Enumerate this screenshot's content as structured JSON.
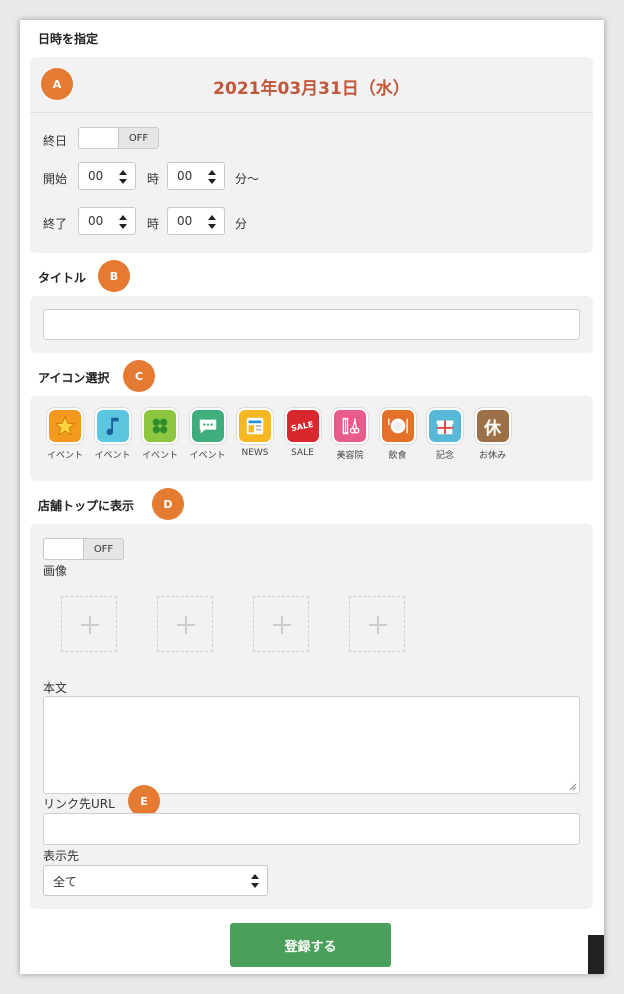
{
  "datetime": {
    "section_title": "日時を指定",
    "badge": "A",
    "date": "2021年03月31日（水）",
    "allday_label": "終日",
    "allday_toggle": "OFF",
    "start_label": "開始",
    "start_hour": "00",
    "start_minute": "00",
    "end_label": "終了",
    "end_hour": "00",
    "end_minute": "00",
    "hour_unit": "時",
    "minute_unit_start": "分～",
    "minute_unit_end": "分"
  },
  "title_section": {
    "label": "タイトル",
    "badge": "B",
    "value": ""
  },
  "icon_section": {
    "label": "アイコン選択",
    "badge": "C",
    "icons": [
      {
        "caption": "イベント",
        "name": "star-icon",
        "color": "#f39a1e"
      },
      {
        "caption": "イベント",
        "name": "music-note-icon",
        "color": "#5cc6e0"
      },
      {
        "caption": "イベント",
        "name": "clover-icon",
        "color": "#8cc63f"
      },
      {
        "caption": "イベント",
        "name": "chat-bubble-icon",
        "color": "#3fae7e"
      },
      {
        "caption": "NEWS",
        "name": "news-icon",
        "color": "#f5b823"
      },
      {
        "caption": "SALE",
        "name": "sale-icon",
        "color": "#d8272d",
        "text": "SALE"
      },
      {
        "caption": "美容院",
        "name": "comb-scissors-icon",
        "color": "#e85c8a"
      },
      {
        "caption": "飲食",
        "name": "plate-icon",
        "color": "#e5702a"
      },
      {
        "caption": "記念",
        "name": "gift-icon",
        "color": "#58b8d8"
      },
      {
        "caption": "お休み",
        "name": "rest-icon",
        "color": "#9b7046",
        "text": "休"
      }
    ]
  },
  "store_top": {
    "label": "店舗トップに表示",
    "badge": "D",
    "toggle": "OFF",
    "image_label": "画像",
    "body_label": "本文",
    "link_label": "リンク先URL",
    "link_badge": "E",
    "display_label": "表示先",
    "display_value": "全て"
  },
  "submit_label": "登録する"
}
